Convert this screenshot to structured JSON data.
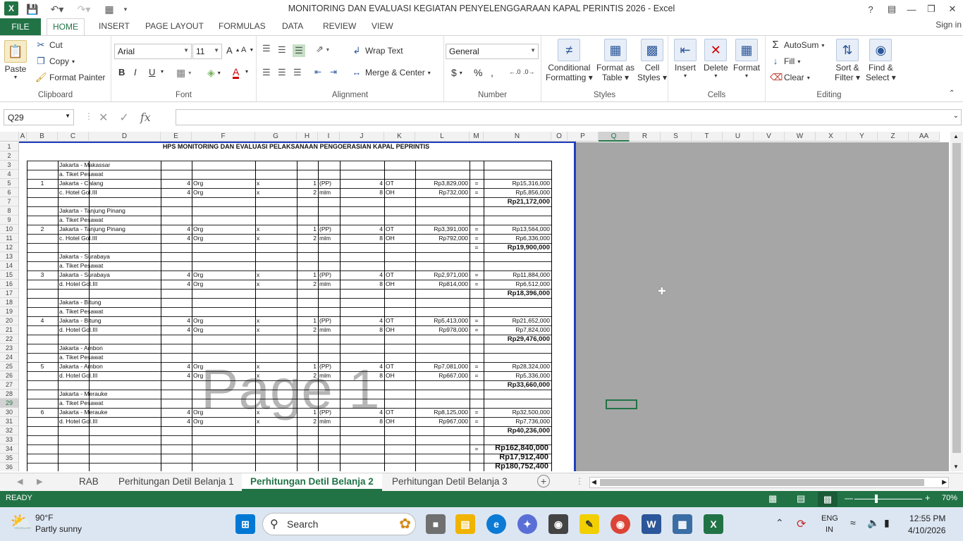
{
  "window": {
    "title": "MONITORING DAN EVALUASI KEGIATAN PENYELENGGARAAN KAPAL PERINTIS 2026 - Excel",
    "help": "?",
    "signin": "Sign in"
  },
  "ribbon_tabs": [
    "FILE",
    "HOME",
    "INSERT",
    "PAGE LAYOUT",
    "FORMULAS",
    "DATA",
    "REVIEW",
    "VIEW"
  ],
  "active_tab": "HOME",
  "clipboard": {
    "paste": "Paste",
    "cut": "Cut",
    "copy": "Copy",
    "format_painter": "Format Painter",
    "label": "Clipboard"
  },
  "font": {
    "name": "Arial",
    "size": "11",
    "bold": "B",
    "italic": "I",
    "underline": "U",
    "label": "Font"
  },
  "alignment": {
    "wrap_text": "Wrap Text",
    "merge_center": "Merge & Center",
    "label": "Alignment"
  },
  "number": {
    "format": "General",
    "currency": "$",
    "percent": "%",
    "comma": ",",
    "label": "Number"
  },
  "styles": {
    "conditional": "Conditional",
    "conditional2": "Formatting",
    "format_table": "Format as",
    "format_table2": "Table",
    "cell_styles": "Cell",
    "cell_styles2": "Styles",
    "label": "Styles"
  },
  "cells": {
    "insert": "Insert",
    "delete": "Delete",
    "format": "Format",
    "label": "Cells"
  },
  "editing": {
    "autosum": "AutoSum",
    "fill": "Fill",
    "clear": "Clear",
    "sort": "Sort &",
    "sort2": "Filter",
    "find": "Find &",
    "find2": "Select",
    "label": "Editing"
  },
  "formula_bar": {
    "name_box": "Q29",
    "fx": "fx",
    "formula": ""
  },
  "columns": [
    "A",
    "B",
    "C",
    "D",
    "E",
    "F",
    "G",
    "H",
    "I",
    "J",
    "K",
    "L",
    "M",
    "N",
    "O",
    "P",
    "Q",
    "R",
    "S",
    "T",
    "U",
    "V",
    "W",
    "X",
    "Y",
    "Z",
    "AA"
  ],
  "selected_column": "Q",
  "selected_row": "29",
  "sheet_title": "HPS MONITORING DAN EVALUASI PELAKSANAAN PENGOERASIAN KAPAL PEPRINTIS",
  "rows": [
    {
      "n": "1"
    },
    {
      "n": "2"
    },
    {
      "n": "3",
      "c": "Jakarta - Makassar"
    },
    {
      "n": "4",
      "c": "a. Tiket Pesawat"
    },
    {
      "n": "5",
      "b": "1",
      "c": "Jakarta - Calang",
      "e": "4",
      "f": "Org",
      "g": "x",
      "h": "1",
      "i": "(PP)",
      "j": "4",
      "k": "OT",
      "l": "Rp3,829,000",
      "m": "=",
      "nn": "Rp15,316,000"
    },
    {
      "n": "6",
      "c": "c. Hotel Gol.III",
      "e": "4",
      "f": "Org",
      "g": "x",
      "h": "2",
      "i": "mlm",
      "j": "8",
      "k": "OH",
      "l": "Rp732,000",
      "m": "=",
      "nn": "Rp5,856,000"
    },
    {
      "n": "7",
      "tot": "Rp21,172,000"
    },
    {
      "n": "8",
      "c": "Jakarta - Tanjung Pinang"
    },
    {
      "n": "9",
      "c": "a. Tiket Pesawat"
    },
    {
      "n": "10",
      "b": "2",
      "c": "Jakarta - Tanjung Pinang",
      "e": "4",
      "f": "Org",
      "g": "x",
      "h": "1",
      "i": "(PP)",
      "j": "4",
      "k": "OT",
      "l": "Rp3,391,000",
      "m": "=",
      "nn": "Rp13,564,000"
    },
    {
      "n": "11",
      "c": "c. Hotel Gol.III",
      "e": "4",
      "f": "Org",
      "g": "x",
      "h": "2",
      "i": "mlm",
      "j": "8",
      "k": "OH",
      "l": "Rp792,000",
      "m": "=",
      "nn": "Rp6,336,000"
    },
    {
      "n": "12",
      "m": "=",
      "tot": "Rp19,900,000"
    },
    {
      "n": "13",
      "c": "Jakarta - Surabaya"
    },
    {
      "n": "14",
      "c": "a. Tiket Pesawat"
    },
    {
      "n": "15",
      "b": "3",
      "c": "Jakarta - Surabaya",
      "e": "4",
      "f": "Org",
      "g": "x",
      "h": "1",
      "i": "(PP)",
      "j": "4",
      "k": "OT",
      "l": "Rp2,971,000",
      "m": "=",
      "nn": "Rp11,884,000"
    },
    {
      "n": "16",
      "c": "d. Hotel Gol.III",
      "e": "4",
      "f": "Org",
      "g": "x",
      "h": "2",
      "i": "mlm",
      "j": "8",
      "k": "OH",
      "l": "Rp814,000",
      "m": "=",
      "nn": "Rp6,512,000"
    },
    {
      "n": "17",
      "tot": "Rp18,396,000"
    },
    {
      "n": "18",
      "c": "Jakarta - Bitung"
    },
    {
      "n": "19",
      "c": "a. Tiket Pesawat"
    },
    {
      "n": "20",
      "b": "4",
      "c": "Jakarta - Bitung",
      "e": "4",
      "f": "Org",
      "g": "x",
      "h": "1",
      "i": "(PP)",
      "j": "4",
      "k": "OT",
      "l": "Rp5,413,000",
      "m": "=",
      "nn": "Rp21,652,000"
    },
    {
      "n": "21",
      "c": "d. Hotel Gol.III",
      "e": "4",
      "f": "Org",
      "g": "x",
      "h": "2",
      "i": "mlm",
      "j": "8",
      "k": "OH",
      "l": "Rp978,000",
      "m": "=",
      "nn": "Rp7,824,000"
    },
    {
      "n": "22",
      "tot": "Rp29,476,000"
    },
    {
      "n": "23",
      "c": "Jakarta - Ambon"
    },
    {
      "n": "24",
      "c": "a. Tiket Pesawat"
    },
    {
      "n": "25",
      "b": "5",
      "c": "Jakarta - Ambon",
      "e": "4",
      "f": "Org",
      "g": "x",
      "h": "1",
      "i": "(PP)",
      "j": "4",
      "k": "OT",
      "l": "Rp7,081,000",
      "m": "=",
      "nn": "Rp28,324,000"
    },
    {
      "n": "26",
      "c": "d. Hotel Gol.III",
      "e": "4",
      "f": "Org",
      "g": "x",
      "h": "2",
      "i": "mlm",
      "j": "8",
      "k": "OH",
      "l": "Rp667,000",
      "m": "=",
      "nn": "Rp5,336,000"
    },
    {
      "n": "27",
      "tot": "Rp33,660,000"
    },
    {
      "n": "28",
      "c": "Jakarta - Merauke"
    },
    {
      "n": "29",
      "c": "a. Tiket Pesawat"
    },
    {
      "n": "30",
      "b": "6",
      "c": "Jakarta - Merauke",
      "e": "4",
      "f": "Org",
      "g": "x",
      "h": "1",
      "i": "(PP)",
      "j": "4",
      "k": "OT",
      "l": "Rp8,125,000",
      "m": "=",
      "nn": "Rp32,500,000"
    },
    {
      "n": "31",
      "c": "d. Hotel Gol.III",
      "e": "4",
      "f": "Org",
      "g": "x",
      "h": "2",
      "i": "mlm",
      "j": "8",
      "k": "OH",
      "l": "Rp967,000",
      "m": "=",
      "nn": "Rp7,736,000"
    },
    {
      "n": "32",
      "tot": "Rp40,236,000"
    },
    {
      "n": "33"
    },
    {
      "n": "34",
      "m": "=",
      "big": "Rp162,840,000"
    },
    {
      "n": "35",
      "big": "Rp17,912,400"
    },
    {
      "n": "36",
      "big": "Rp180,752,400"
    }
  ],
  "watermark": "Page 1",
  "sheet_tabs": [
    "RAB",
    "Perhitungan Detil Belanja 1",
    "Perhitungan Detil Belanja 2",
    "Perhitungan Detil Belanja 3"
  ],
  "active_sheet": "Perhitungan Detil Belanja 2",
  "status": {
    "ready": "READY",
    "zoom": "70%"
  },
  "taskbar": {
    "weather_temp": "90°F",
    "weather_desc": "Partly sunny",
    "search": "Search",
    "lang1": "ENG",
    "lang2": "IN",
    "time": "12:55 PM",
    "date": "4/10/2026"
  },
  "colors": {
    "excel_green": "#217346",
    "page_break": "#1f3fbf"
  }
}
